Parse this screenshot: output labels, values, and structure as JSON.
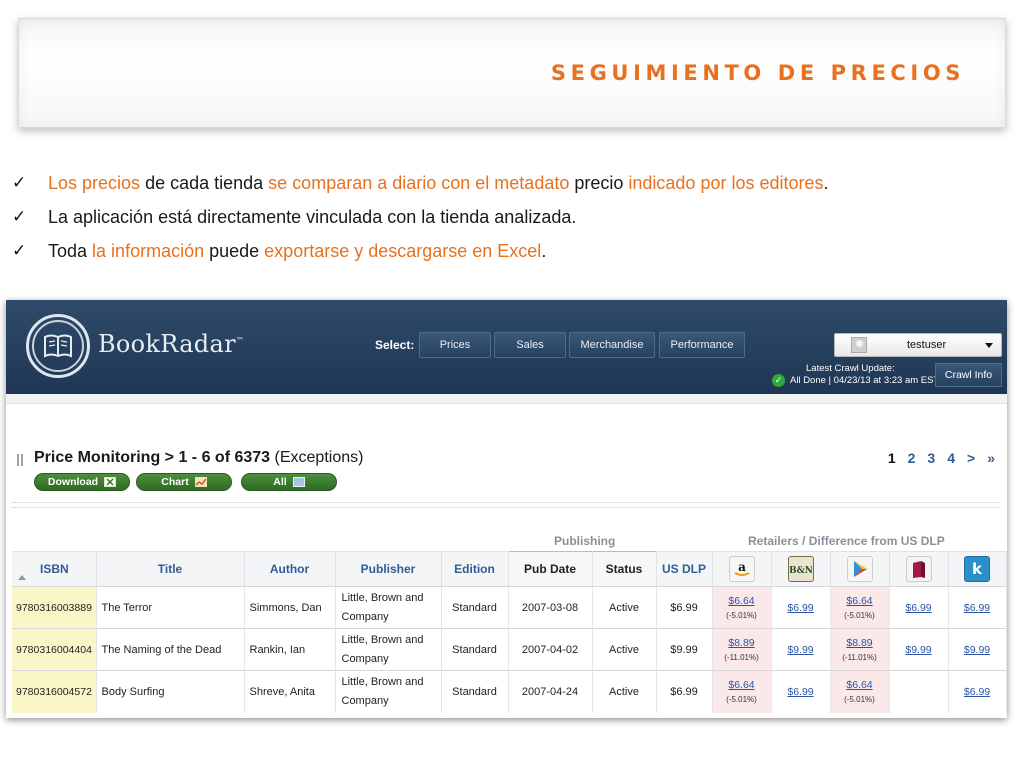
{
  "slide": {
    "title": "SEGUIMIENTO DE PRECIOS",
    "bullets": [
      {
        "parts": [
          {
            "t": "Los precios",
            "hl": true
          },
          {
            "t": " de cada tienda ",
            "hl": false
          },
          {
            "t": "se comparan a diario con el metadato",
            "hl": true
          },
          {
            "t": " precio ",
            "hl": false
          },
          {
            "t": "indicado por los editores",
            "hl": true
          },
          {
            "t": ".",
            "hl": false
          }
        ]
      },
      {
        "parts": [
          {
            "t": "La aplicación está directamente vinculada con la tienda analizada.",
            "hl": false
          }
        ]
      },
      {
        "parts": [
          {
            "t": "Toda ",
            "hl": false
          },
          {
            "t": "la información",
            "hl": true
          },
          {
            "t": " puede ",
            "hl": false
          },
          {
            "t": "exportarse y descargarse en Excel",
            "hl": true
          },
          {
            "t": ".",
            "hl": false
          }
        ]
      }
    ],
    "check_glyph": "✓"
  },
  "app": {
    "logo_text": "BookRadar",
    "logo_tm": "™",
    "select_label": "Select:",
    "nav": [
      "Prices",
      "Sales",
      "Merchandise",
      "Performance"
    ],
    "user": "testuser",
    "crawl_label": "Latest Crawl Update:",
    "crawl_status": "All Done | 04/23/13 at 3:23 am EST",
    "crawl_button": "Crawl Info",
    "page_title": "Price Monitoring > 1 - 6 of 6373",
    "page_subtitle": "(Exceptions)",
    "pager": [
      "1",
      "2",
      "3",
      "4",
      ">",
      "»"
    ],
    "actions": {
      "download": "Download",
      "chart": "Chart",
      "all": "All"
    },
    "groups": {
      "publishing": "Publishing",
      "retailers": "Retailers / Difference from US DLP"
    },
    "columns": [
      "ISBN",
      "Title",
      "Author",
      "Publisher",
      "Edition",
      "Pub Date",
      "Status",
      "US DLP"
    ],
    "retailers": [
      {
        "icon": "amazon-icon",
        "color": "#f4f4f4"
      },
      {
        "icon": "barnes-noble-icon",
        "color": "#2e6b3b"
      },
      {
        "icon": "google-play-icon",
        "color": "#f4f4f4"
      },
      {
        "icon": "kobo-books-icon",
        "color": "#a3174a"
      },
      {
        "icon": "kindle-k-icon",
        "color": "#2a90c8"
      }
    ],
    "rows": [
      {
        "isbn": "9780316003889",
        "title": "The Terror",
        "author": "Simmons, Dan",
        "publisher": "Little, Brown and Company",
        "edition": "Standard",
        "pub_date": "2007-03-08",
        "status": "Active",
        "us_dlp": "$6.99",
        "r": [
          {
            "p": "$6.64",
            "d": "(-5.01%)"
          },
          {
            "p": "$6.99",
            "d": ""
          },
          {
            "p": "$6.64",
            "d": "(-5.01%)"
          },
          {
            "p": "$6.99",
            "d": ""
          },
          {
            "p": "$6.99",
            "d": ""
          }
        ]
      },
      {
        "isbn": "9780316004404",
        "title": "The Naming of the Dead",
        "author": "Rankin, Ian",
        "publisher": "Little, Brown and Company",
        "edition": "Standard",
        "pub_date": "2007-04-02",
        "status": "Active",
        "us_dlp": "$9.99",
        "r": [
          {
            "p": "$8.89",
            "d": "(-11.01%)"
          },
          {
            "p": "$9.99",
            "d": ""
          },
          {
            "p": "$8.89",
            "d": "(-11.01%)"
          },
          {
            "p": "$9.99",
            "d": ""
          },
          {
            "p": "$9.99",
            "d": ""
          }
        ]
      },
      {
        "isbn": "9780316004572",
        "title": "Body Surfing",
        "author": "Shreve, Anita",
        "publisher": "Little, Brown and Company",
        "edition": "Standard",
        "pub_date": "2007-04-24",
        "status": "Active",
        "us_dlp": "$6.99",
        "r": [
          {
            "p": "$6.64",
            "d": "(-5.01%)"
          },
          {
            "p": "$6.99",
            "d": ""
          },
          {
            "p": "$6.64",
            "d": "(-5.01%)"
          },
          {
            "p": "",
            "d": ""
          },
          {
            "p": "$6.99",
            "d": ""
          }
        ]
      }
    ]
  }
}
